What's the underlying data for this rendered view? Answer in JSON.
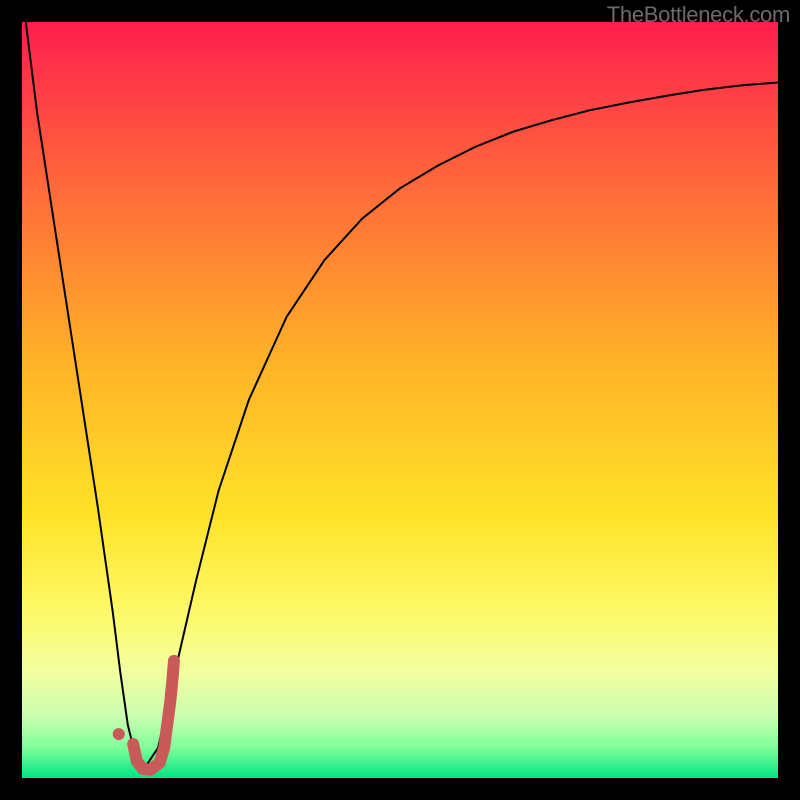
{
  "watermark": "TheBottleneck.com",
  "chart_data": {
    "type": "line",
    "title": "",
    "xlabel": "",
    "ylabel": "",
    "xlim": [
      0,
      100
    ],
    "ylim": [
      0,
      100
    ],
    "grid": false,
    "legend": false,
    "background_gradient": {
      "stops": [
        {
          "offset": 0.0,
          "color": "#ff1e4e"
        },
        {
          "offset": 0.22,
          "color": "#ff6a3a"
        },
        {
          "offset": 0.45,
          "color": "#ffb227"
        },
        {
          "offset": 0.65,
          "color": "#ffe228"
        },
        {
          "offset": 0.78,
          "color": "#fdf968"
        },
        {
          "offset": 0.86,
          "color": "#f2ffa0"
        },
        {
          "offset": 0.92,
          "color": "#c8ffb0"
        },
        {
          "offset": 0.96,
          "color": "#7eff9a"
        },
        {
          "offset": 1.0,
          "color": "#00e383"
        }
      ]
    },
    "series": [
      {
        "name": "curve",
        "color": "#000000",
        "width": 2.0,
        "x": [
          0.5,
          2,
          4,
          6,
          8,
          10,
          12,
          13,
          14,
          15,
          16,
          18,
          20,
          23,
          26,
          30,
          35,
          40,
          45,
          50,
          55,
          60,
          65,
          70,
          75,
          80,
          85,
          90,
          95,
          100
        ],
        "y": [
          100,
          88,
          75,
          62,
          49,
          36,
          22,
          14,
          7,
          3,
          1,
          4,
          13,
          26,
          38,
          50,
          61,
          68.5,
          74,
          78,
          81,
          83.5,
          85.5,
          87,
          88.3,
          89.3,
          90.2,
          91,
          91.6,
          92
        ]
      },
      {
        "name": "marker-j",
        "color": "#c85a5a",
        "width": 12,
        "linecap": "round",
        "x": [
          14.7,
          15.2,
          16.0,
          17.0,
          18.2,
          18.8,
          19.2,
          19.6,
          19.9,
          20.1
        ],
        "y": [
          4.5,
          2.2,
          1.2,
          1.1,
          2.0,
          4.0,
          7.0,
          10.0,
          13.0,
          15.5
        ]
      },
      {
        "name": "marker-dot",
        "type": "scatter",
        "color": "#c85a5a",
        "radius": 6,
        "x": [
          12.8
        ],
        "y": [
          5.8
        ]
      }
    ]
  }
}
